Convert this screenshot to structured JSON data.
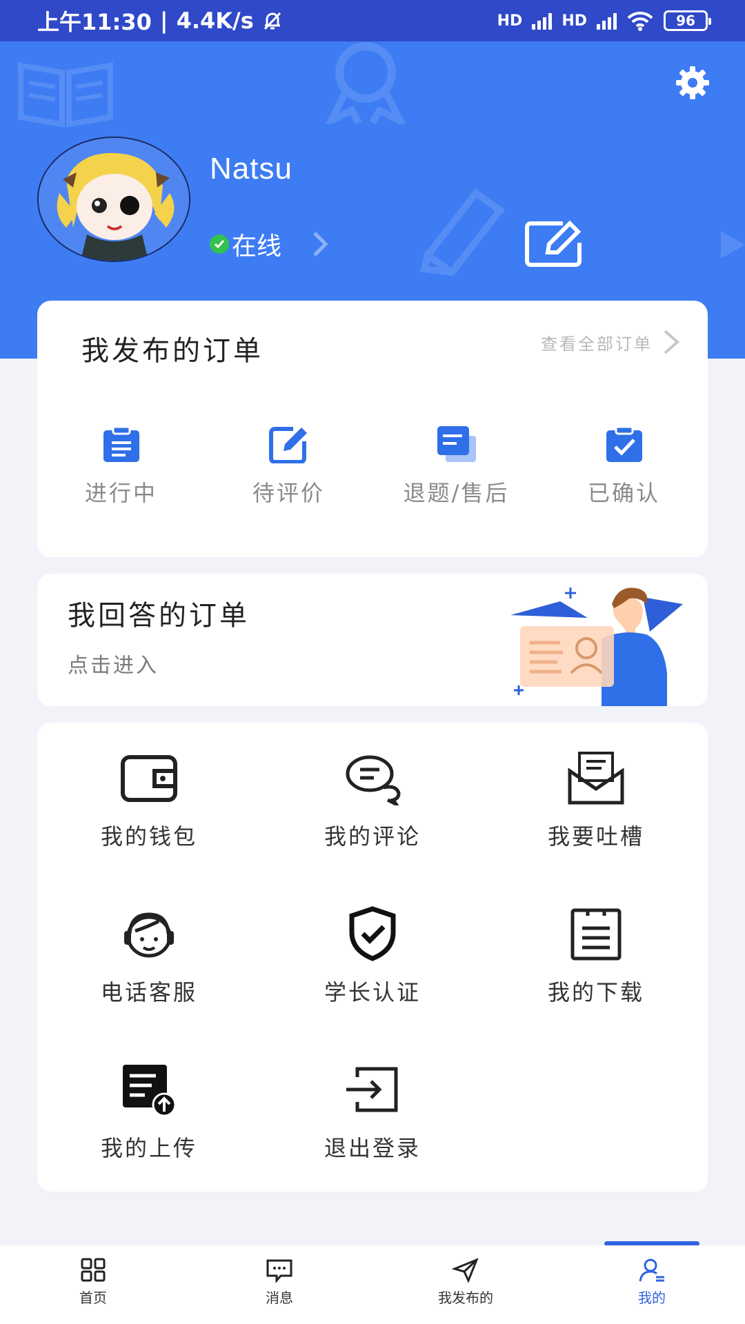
{
  "status_bar": {
    "time": "上午11:30",
    "speed": "4.4K/s",
    "battery": "96",
    "hd1": "HD",
    "hd2": "HD"
  },
  "profile": {
    "username": "Natsu",
    "status": "在线"
  },
  "published_orders": {
    "title": "我发布的订单",
    "view_all": "查看全部订单",
    "items": [
      {
        "label": "进行中",
        "icon": "clipboard-icon"
      },
      {
        "label": "待评价",
        "icon": "edit-review-icon"
      },
      {
        "label": "退题/售后",
        "icon": "document-return-icon"
      },
      {
        "label": "已确认",
        "icon": "check-clipboard-icon"
      }
    ]
  },
  "answered_orders": {
    "title": "我回答的订单",
    "subtitle": "点击进入"
  },
  "menu": {
    "items": [
      {
        "label": "我的钱包",
        "icon": "wallet-icon"
      },
      {
        "label": "我的评论",
        "icon": "comment-icon"
      },
      {
        "label": "我要吐槽",
        "icon": "envelope-icon"
      },
      {
        "label": "电话客服",
        "icon": "headset-icon"
      },
      {
        "label": "学长认证",
        "icon": "shield-check-icon"
      },
      {
        "label": "我的下载",
        "icon": "document-list-icon"
      },
      {
        "label": "我的上传",
        "icon": "upload-icon"
      },
      {
        "label": "退出登录",
        "icon": "logout-icon"
      }
    ]
  },
  "bottom_nav": {
    "items": [
      {
        "label": "首页",
        "icon": "grid-icon"
      },
      {
        "label": "消息",
        "icon": "message-icon"
      },
      {
        "label": "我发布的",
        "icon": "send-icon"
      },
      {
        "label": "我的",
        "icon": "user-icon"
      }
    ],
    "active": "我的"
  },
  "colors": {
    "header": "#3d7cf3",
    "status_bar": "#2f49c8",
    "accent": "#2f63e0",
    "online": "#35c14f"
  }
}
